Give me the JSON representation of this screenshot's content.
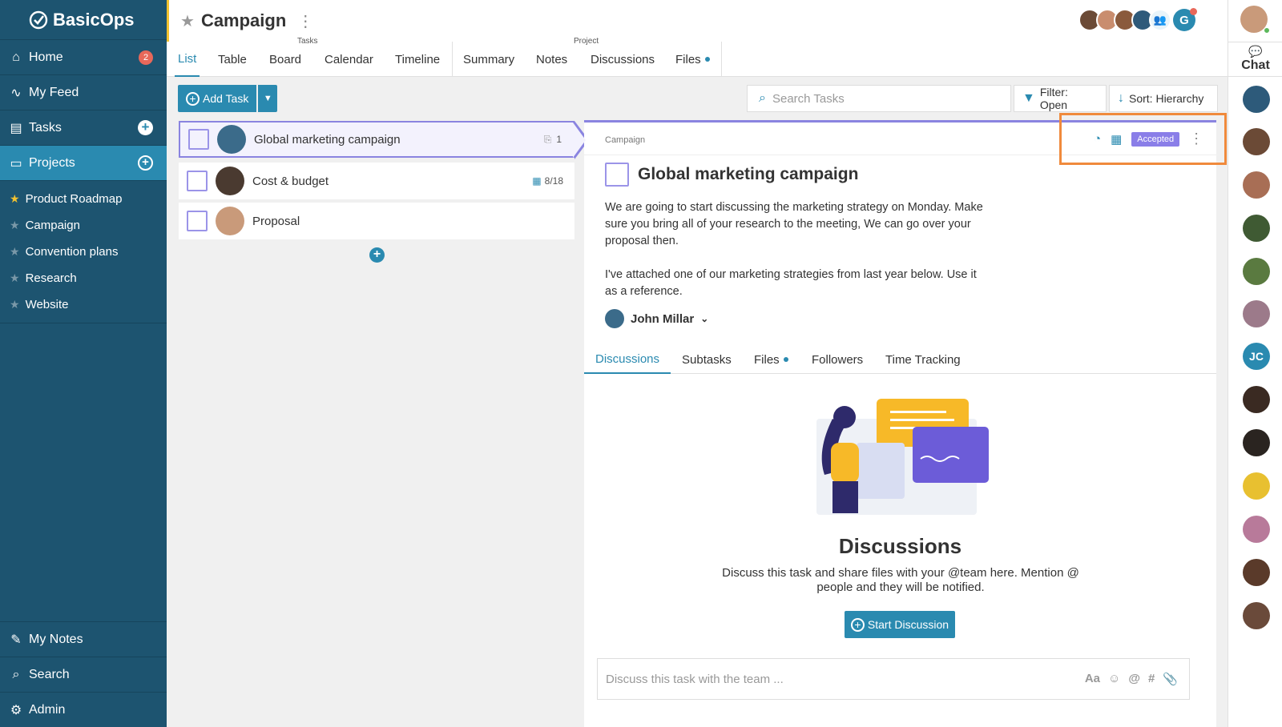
{
  "app": {
    "name": "BasicOps"
  },
  "sidebar": {
    "nav": [
      {
        "label": "Home",
        "badge": "2"
      },
      {
        "label": "My Feed"
      },
      {
        "label": "Tasks"
      },
      {
        "label": "Projects"
      }
    ],
    "projects": [
      {
        "label": "Product Roadmap",
        "starred": true
      },
      {
        "label": "Campaign"
      },
      {
        "label": "Convention plans"
      },
      {
        "label": "Research"
      },
      {
        "label": "Website"
      }
    ],
    "bottom": [
      {
        "label": "My Notes"
      },
      {
        "label": "Search"
      },
      {
        "label": "Admin"
      }
    ]
  },
  "header": {
    "title": "Campaign"
  },
  "tabs": {
    "group_tasks": "Tasks",
    "group_project": "Project",
    "items": [
      "List",
      "Table",
      "Board",
      "Calendar",
      "Timeline",
      "Summary",
      "Notes",
      "Discussions",
      "Files"
    ]
  },
  "toolbar": {
    "add_task": "Add Task",
    "search_placeholder": "Search Tasks",
    "filter": "Filter: Open",
    "sort": "Sort: Hierarchy"
  },
  "tasks": [
    {
      "name": "Global marketing campaign",
      "meta": "1"
    },
    {
      "name": "Cost & budget",
      "meta": "8/18"
    },
    {
      "name": "Proposal",
      "meta": ""
    }
  ],
  "detail": {
    "breadcrumb": "Campaign",
    "status": "Accepted",
    "title": "Global marketing campaign",
    "description": [
      "We are going to start discussing the marketing strategy on Monday. Make sure you bring all of your research to the meeting, We can go over your proposal then.",
      "I've attached one of our marketing strategies from last year below. Use it as a reference."
    ],
    "owner": "John Millar",
    "tabs": [
      "Discussions",
      "Subtasks",
      "Files",
      "Followers",
      "Time Tracking"
    ],
    "empty_title": "Discussions",
    "empty_text": "Discuss this task and share files with your @team here. Mention @ people and they will be notified.",
    "start_button": "Start Discussion",
    "composer_placeholder": "Discuss this task with the team ...",
    "composer_icons": [
      "Aa",
      "☺",
      "@",
      "#",
      "📎"
    ]
  },
  "rail": {
    "chat_label": "Chat",
    "initials": "JC"
  },
  "colors": {
    "sidebar": "#1d5470",
    "accent": "#2a8ab0",
    "purple": "#8a84e0",
    "highlight": "#f08a3c"
  }
}
